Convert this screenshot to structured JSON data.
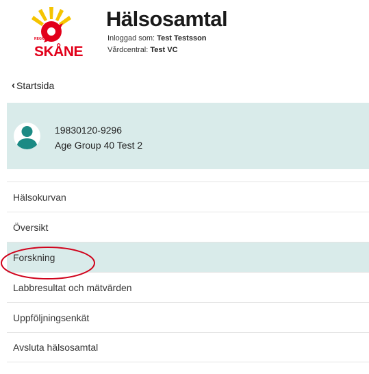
{
  "brand": {
    "logo_word": "SKÅNE",
    "logo_region": "REGION",
    "accent": "#e2001a",
    "sun": "#f5c400"
  },
  "header": {
    "title": "Hälsosamtal",
    "user_label": "Inloggad som:",
    "user_name": "Test Testsson",
    "vc_label": "Vårdcentral:",
    "vc_name": "Test VC"
  },
  "back": {
    "label": "Startsida",
    "icon": "chevron-left-icon"
  },
  "patient": {
    "id": "19830120-9296",
    "name": "Age Group 40 Test 2",
    "avatar_icon": "person-icon",
    "card_color": "#d9ebea",
    "avatar_color": "#1b8a84"
  },
  "nav": {
    "items": [
      {
        "label": "Hälsokurvan"
      },
      {
        "label": "Översikt"
      },
      {
        "label": "Forskning",
        "active": true
      },
      {
        "label": "Labbresultat och mätvärden"
      },
      {
        "label": "Uppföljningsenkät"
      },
      {
        "label": "Avsluta hälsosamtal"
      }
    ]
  },
  "annotation": {
    "shape": "ellipse",
    "color": "#d0021b",
    "target": "Forskning"
  }
}
